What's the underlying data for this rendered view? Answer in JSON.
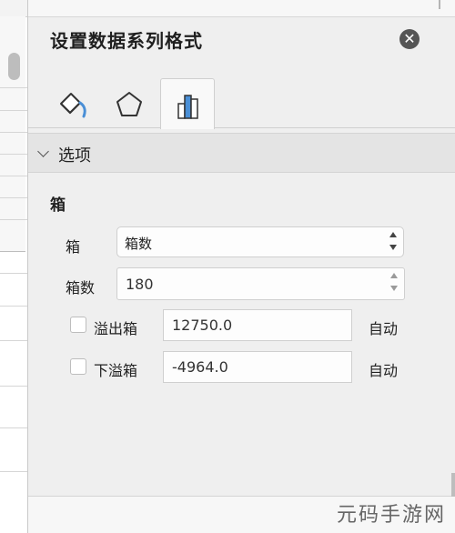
{
  "panel": {
    "title": "设置数据系列格式",
    "close_icon": "close-icon"
  },
  "tabs": [
    {
      "icon": "fill-line-icon",
      "active": false
    },
    {
      "icon": "effects-pentagon-icon",
      "active": false
    },
    {
      "icon": "series-options-bar-chart-icon",
      "active": true
    }
  ],
  "section": {
    "label": "选项",
    "group_title": "箱"
  },
  "bins": {
    "bin_label": "箱",
    "bin_select_value": "箱数",
    "count_label": "箱数",
    "count_value": "180"
  },
  "overflow": {
    "label": "溢出箱",
    "value": "12750.0",
    "auto_label": "自动",
    "checked": false
  },
  "underflow": {
    "label": "下溢箱",
    "value": "-4964.0",
    "auto_label": "自动",
    "checked": false
  },
  "watermark": "元码手游网",
  "colors": {
    "accent_blue": "#4a8fd6",
    "panel_bg": "#efefef"
  }
}
